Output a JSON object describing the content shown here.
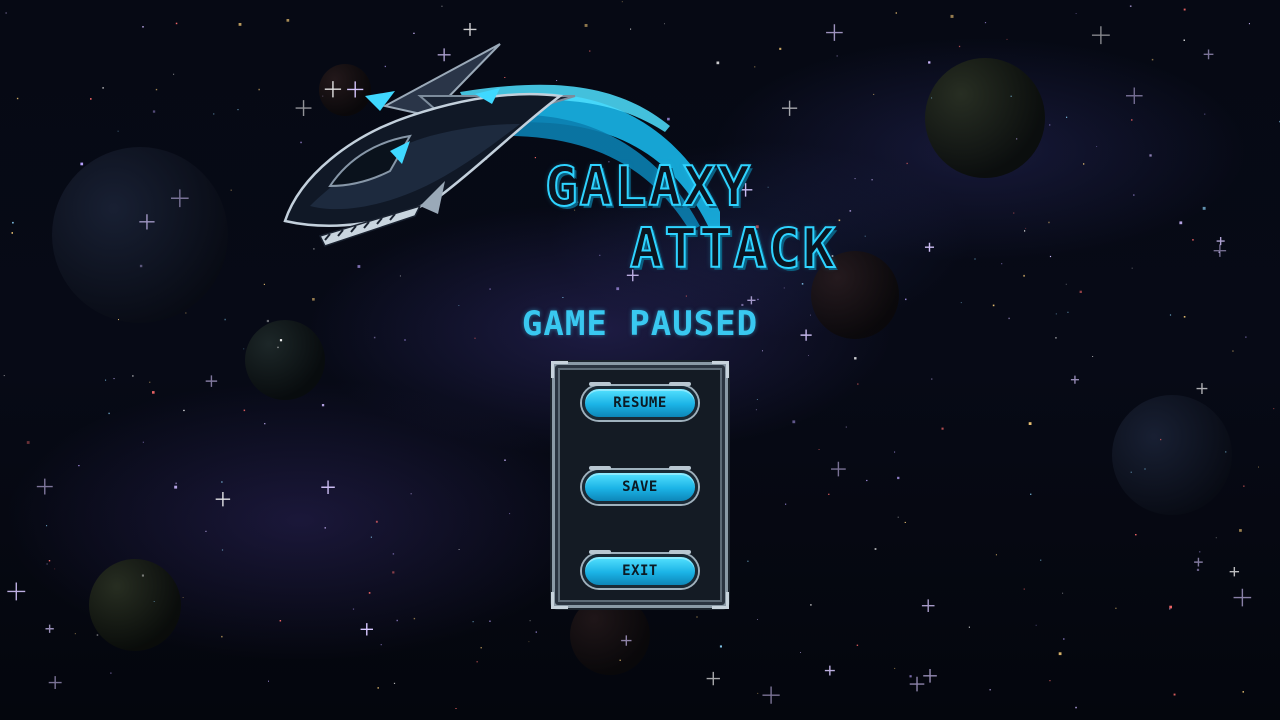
{
  "game": {
    "title_line_1": "GALAXY",
    "title_line_2": "ATTACK",
    "paused_text": "GAME PAUSED"
  },
  "menu": {
    "buttons": [
      {
        "label": "RESUME"
      },
      {
        "label": "SAVE"
      },
      {
        "label": "EXIT"
      }
    ]
  },
  "colors": {
    "accent_cyan": "#39c8f0",
    "button_cyan": "#1bb3e6",
    "panel_dark": "#141b24",
    "space_bg": "#060914"
  },
  "icons": {
    "ship": "spaceship-logo-icon"
  }
}
